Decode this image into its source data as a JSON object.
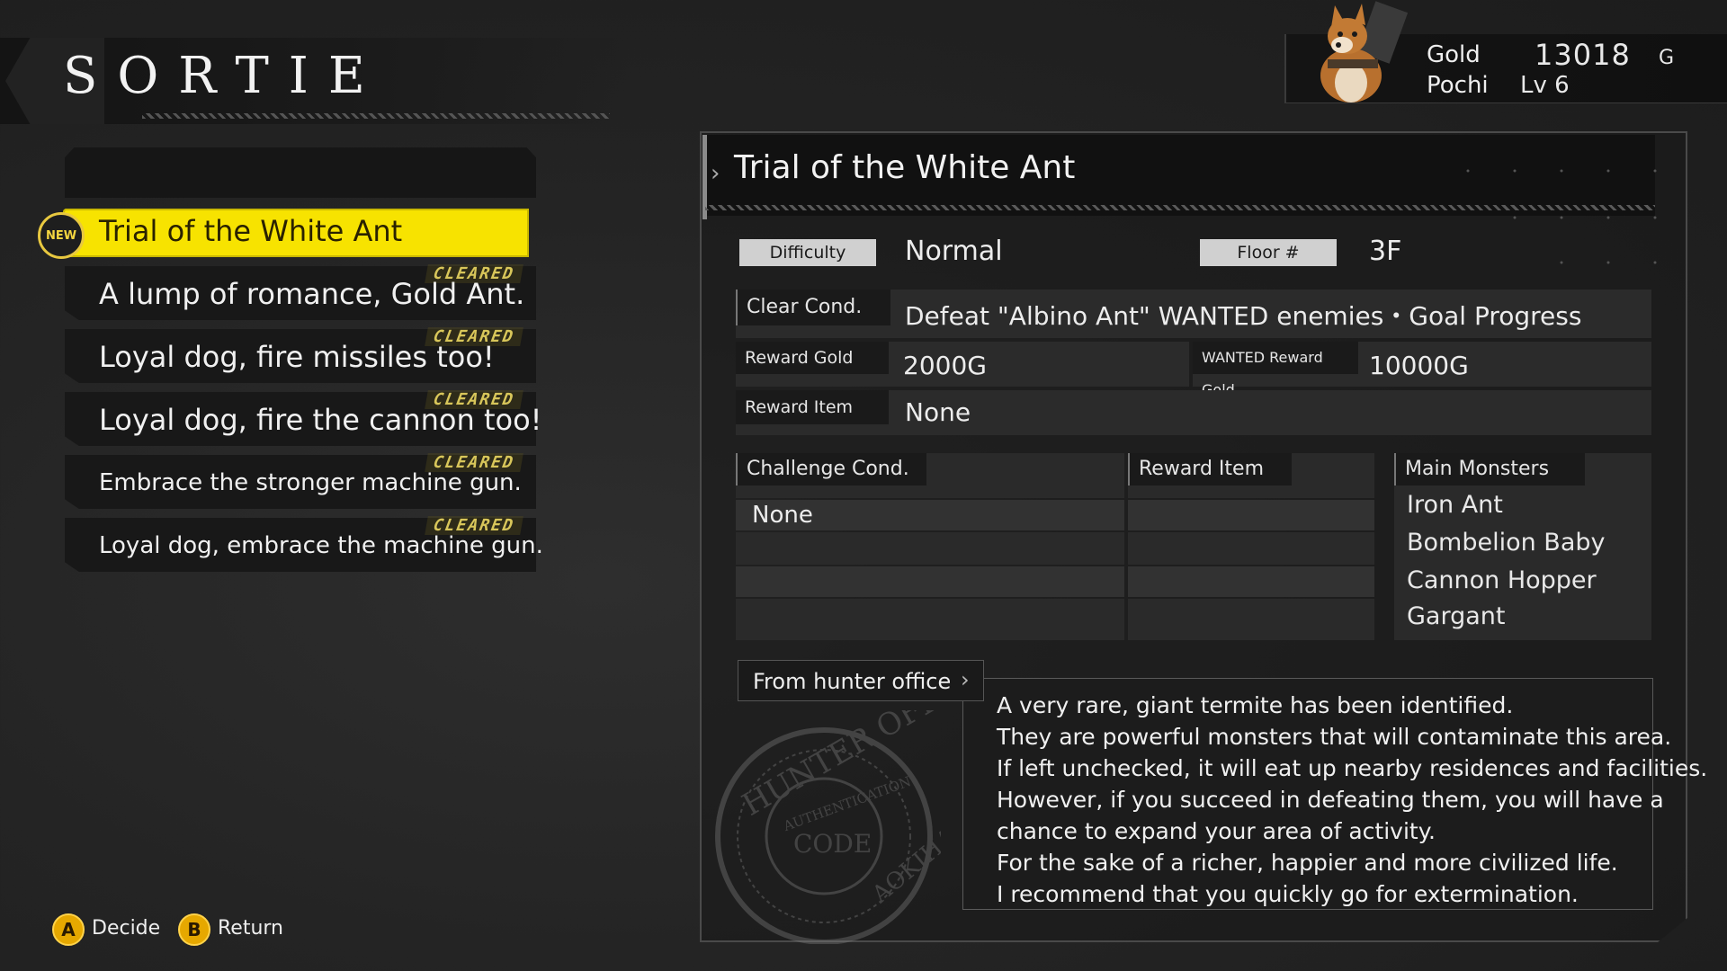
{
  "header": {
    "title": "SORTIE"
  },
  "player": {
    "gold_label": "Gold",
    "gold_value": "13018",
    "gold_unit": "G",
    "name": "Pochi",
    "level": "Lv 6"
  },
  "missions": [
    {
      "label": "Trial of the White Ant",
      "badge": "NEW",
      "selected": true
    },
    {
      "label": "A lump of romance, Gold Ant.",
      "status": "CLEARED"
    },
    {
      "label": "Loyal dog, fire missiles too!",
      "status": "CLEARED"
    },
    {
      "label": "Loyal dog, fire the cannon too!",
      "status": "CLEARED"
    },
    {
      "label": "Embrace the stronger machine gun.",
      "status": "CLEARED"
    },
    {
      "label": "Loyal dog, embrace the machine gun.",
      "status": "CLEARED"
    }
  ],
  "controls": {
    "decide_key": "A",
    "decide_label": "Decide",
    "return_key": "B",
    "return_label": "Return"
  },
  "detail": {
    "title": "Trial of the White Ant",
    "difficulty_label": "Difficulty",
    "difficulty_value": "Normal",
    "floor_label": "Floor #",
    "floor_value": "3F",
    "clear_cond_label": "Clear Cond.",
    "clear_cond_value": "Defeat \"Albino Ant\" WANTED enemies・Goal Progress",
    "reward_gold_label": "Reward Gold",
    "reward_gold_value": "2000G",
    "wanted_reward_label": "WANTED Reward Gold",
    "wanted_reward_value": "10000G",
    "reward_item_label": "Reward Item",
    "reward_item_value": "None",
    "challenge_cond_label": "Challenge Cond.",
    "challenge_cond_value": "None",
    "challenge_reward_label": "Reward Item",
    "main_monsters_label": "Main Monsters",
    "main_monsters": [
      "Iron Ant",
      "Bombelion Baby",
      "Cannon Hopper",
      "Gargant"
    ],
    "source_label": "From hunter office",
    "description": [
      "A very rare, giant termite has been identified.",
      "They are powerful monsters that will contaminate this area.",
      "If left unchecked, it will eat up nearby residences and facilities.",
      "However, if you succeed in defeating them, you will have a",
      "chance to expand your area of activity.",
      "For the sake of a richer, happier and more civilized life.",
      "I recommend that you quickly go for extermination."
    ],
    "stamp_text": [
      "HUNTER OFFICE",
      "AUTHENTICATION",
      "CODE",
      "AOKIHARA"
    ]
  },
  "colors": {
    "highlight": "#f7e300",
    "cleared": "#d8c65a",
    "button": "#e6a800"
  }
}
